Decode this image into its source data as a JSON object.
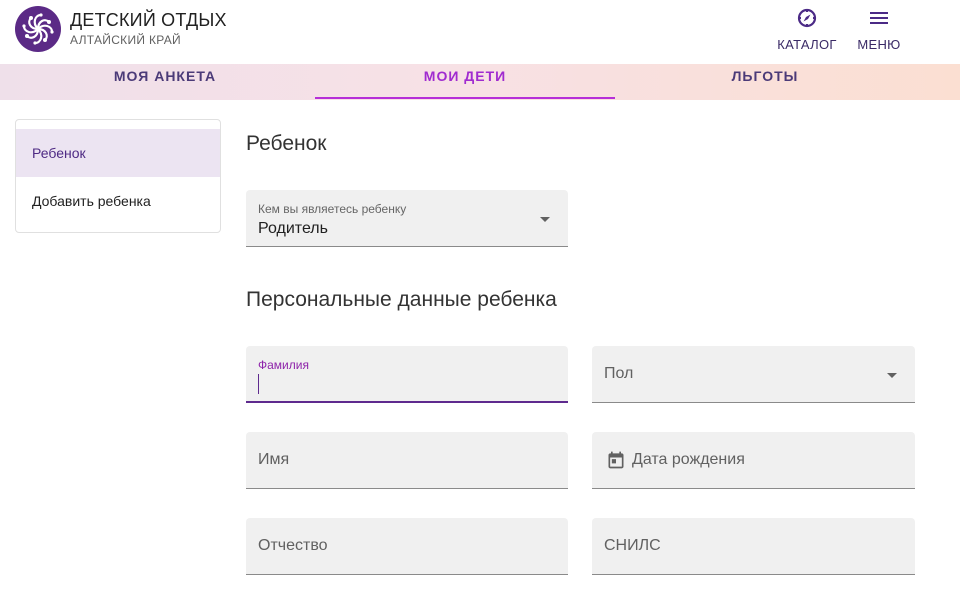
{
  "brand": {
    "title": "ДЕТСКИЙ ОТДЫХ",
    "subtitle": "АЛТАЙСКИЙ КРАЙ",
    "logo_icon": "spiral-logo-icon",
    "logo_color": "#5b2a86"
  },
  "header": {
    "catalog": {
      "label": "КАТАЛОГ",
      "icon": "compass-icon"
    },
    "menu": {
      "label": "МЕНЮ",
      "icon": "hamburger-menu-icon"
    }
  },
  "tabs": [
    {
      "label": "МОЯ АНКЕТА",
      "active": false
    },
    {
      "label": "МОИ ДЕТИ",
      "active": true
    },
    {
      "label": "ЛЬГОТЫ",
      "active": false
    }
  ],
  "sidebar": {
    "items": [
      {
        "label": "Ребенок",
        "selected": true
      },
      {
        "label": "Добавить ребенка",
        "selected": false
      }
    ]
  },
  "main": {
    "section_child": "Ребенок",
    "role_field": {
      "label": "Кем вы являетесь ребенку",
      "value": "Родитель"
    },
    "section_personal": "Персональные данные ребенка",
    "fields": {
      "surname": {
        "label": "Фамилия",
        "value": ""
      },
      "gender": {
        "placeholder": "Пол"
      },
      "name": {
        "placeholder": "Имя"
      },
      "birth_date": {
        "placeholder": "Дата рождения",
        "icon": "calendar-icon"
      },
      "patronymic": {
        "placeholder": "Отчество"
      },
      "snils": {
        "placeholder": "СНИЛС"
      }
    }
  },
  "colors": {
    "accent": "#b62fd8",
    "primary": "#5e2a8e",
    "field_bg": "#f0f0f0"
  }
}
